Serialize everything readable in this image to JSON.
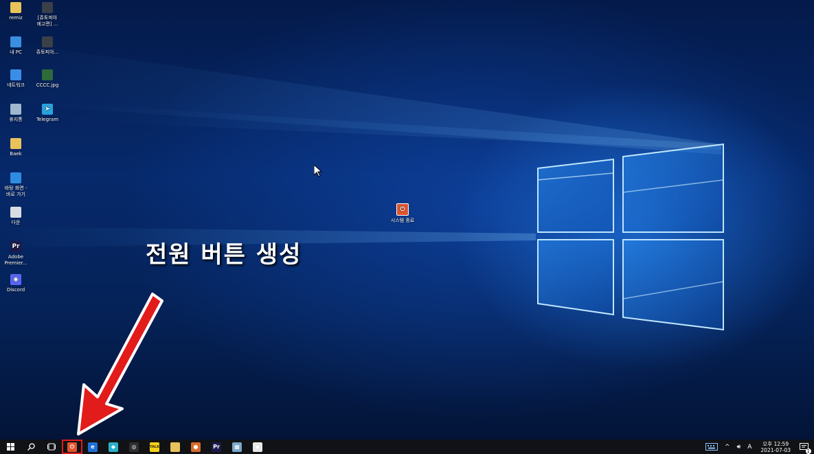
{
  "desktop_icons": [
    {
      "label": "remiz",
      "icon": "folder-icon",
      "color": "#e8c25a",
      "glyph": ""
    },
    {
      "label": "[쥬토피아 에고편] ...",
      "icon": "video-file-icon",
      "color": "#3a3f48",
      "glyph": ""
    },
    {
      "label": "내 PC",
      "icon": "computer-icon",
      "color": "#3a8fe0",
      "glyph": ""
    },
    {
      "label": "쥬토피아...",
      "icon": "video-file-icon",
      "color": "#3a3f48",
      "glyph": ""
    },
    {
      "label": "네트워크",
      "icon": "network-icon",
      "color": "#3b8ee8",
      "glyph": ""
    },
    {
      "label": "CCCC.jpg",
      "icon": "image-file-icon",
      "color": "#2e6b3a",
      "glyph": ""
    },
    {
      "label": "휴지통",
      "icon": "recycle-bin-icon",
      "color": "#9fb7cf",
      "glyph": ""
    },
    {
      "label": "Telegram",
      "icon": "telegram-icon",
      "color": "#2aa2dc",
      "glyph": "➤"
    },
    {
      "label": "Baek",
      "icon": "folder-icon",
      "color": "#e8c25a",
      "glyph": ""
    },
    {
      "label": "바탕 화면 - 바로 가기",
      "icon": "desktop-shortcut-icon",
      "color": "#2f8de0",
      "glyph": ""
    },
    {
      "label": "다운",
      "icon": "document-icon",
      "color": "#d8dde4",
      "glyph": ""
    },
    {
      "label": "Adobe Premier...",
      "icon": "premiere-icon",
      "color": "#1c1a4a",
      "glyph": "Pr"
    },
    {
      "label": "Discord",
      "icon": "discord-icon",
      "color": "#5865f2",
      "glyph": "◉"
    }
  ],
  "center_icon": {
    "label": "시스템 종료",
    "icon": "power-icon",
    "color": "#e0542e"
  },
  "caption": "전원 버튼 생성",
  "taskbar": {
    "start_icon": "windows-start-icon",
    "search_icon": "search-icon",
    "taskview_icon": "task-view-icon",
    "pinned": [
      {
        "name": "power-shortcut",
        "icon": "power-icon",
        "color": "#e0542e",
        "glyph": "⏻",
        "highlighted": true
      },
      {
        "name": "edge",
        "icon": "edge-icon",
        "color": "#1f6fd6",
        "glyph": "e",
        "highlighted": false
      },
      {
        "name": "whale",
        "icon": "whale-browser-icon",
        "color": "#2bb0c9",
        "glyph": "◆",
        "highlighted": false
      },
      {
        "name": "chrome",
        "icon": "chrome-icon",
        "color": "#2e2e2e",
        "glyph": "◎",
        "highlighted": false
      },
      {
        "name": "kakaotalk",
        "icon": "kakaotalk-icon",
        "color": "#f5d31b",
        "glyph": "TALK",
        "highlighted": false
      },
      {
        "name": "file-explorer",
        "icon": "folder-icon",
        "color": "#e8c25a",
        "glyph": "",
        "highlighted": false
      },
      {
        "name": "app-orange",
        "icon": "app-icon",
        "color": "#d96b2a",
        "glyph": "●",
        "highlighted": false
      },
      {
        "name": "premiere",
        "icon": "premiere-icon",
        "color": "#1c1a4a",
        "glyph": "Pr",
        "highlighted": false
      },
      {
        "name": "notepad",
        "icon": "notepad-icon",
        "color": "#7aa7c9",
        "glyph": "▦",
        "highlighted": false
      },
      {
        "name": "image-viewer",
        "icon": "image-viewer-icon",
        "color": "#e8e8e8",
        "glyph": "▪",
        "highlighted": false
      }
    ],
    "tray": {
      "ime_label": "A",
      "time": "오후 12:59",
      "date": "2021-07-03",
      "notification_count": "1"
    }
  }
}
